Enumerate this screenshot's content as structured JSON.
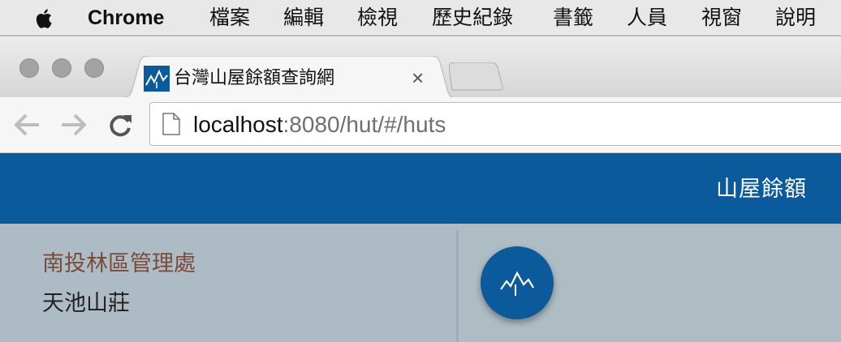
{
  "menubar": {
    "app_name": "Chrome",
    "items": [
      "檔案",
      "編輯",
      "檢視",
      "歷史紀錄",
      "書籤",
      "人員",
      "視窗",
      "說明"
    ]
  },
  "browser": {
    "tab": {
      "title": "台灣山屋餘額查詢網",
      "close": "×"
    },
    "url": {
      "host": "localhost",
      "rest": ":8080/hut/#/huts"
    }
  },
  "app": {
    "title": "山屋餘額",
    "brand_color": "#0b5a9b"
  },
  "list": {
    "district": "南投林區管理處",
    "hut_name": "天池山莊"
  },
  "icons": {
    "apple": "apple-icon",
    "favicon": "mountain-icon",
    "back": "back-arrow-icon",
    "forward": "forward-arrow-icon",
    "reload": "reload-icon",
    "page": "page-icon",
    "fab": "mountain-icon"
  }
}
